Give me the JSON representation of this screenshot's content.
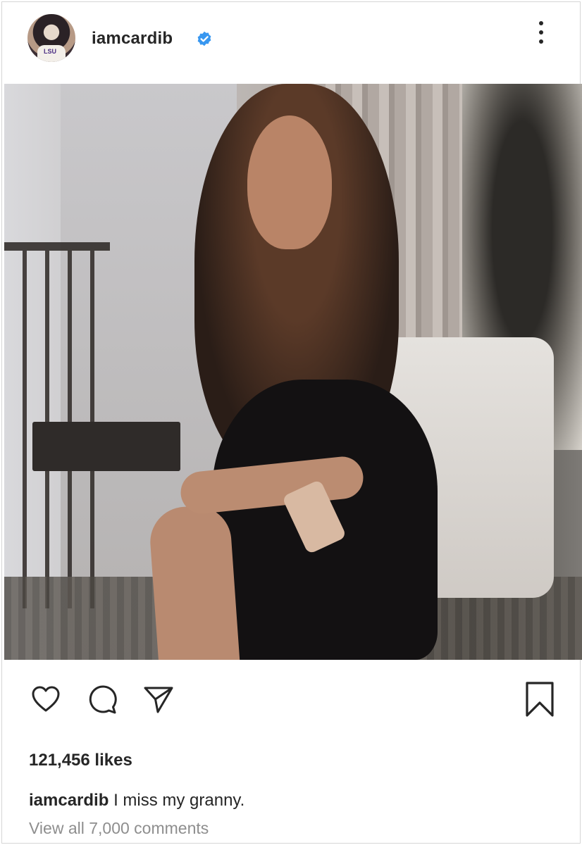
{
  "post": {
    "username": "iamcardib",
    "avatar_icon": "profile-avatar",
    "verified_icon": "verified-badge-icon",
    "verified_color": "#3897f0",
    "more_icon": "more-options-icon",
    "photo_icon": "post-photo",
    "actions": {
      "like_icon": "heart-icon",
      "comment_icon": "comment-bubble-icon",
      "share_icon": "paper-plane-icon",
      "save_icon": "bookmark-icon"
    },
    "likes": "121,456 likes",
    "caption": {
      "username": "iamcardib",
      "text": "I miss my granny."
    },
    "view_comments": "View all 7,000 comments"
  }
}
